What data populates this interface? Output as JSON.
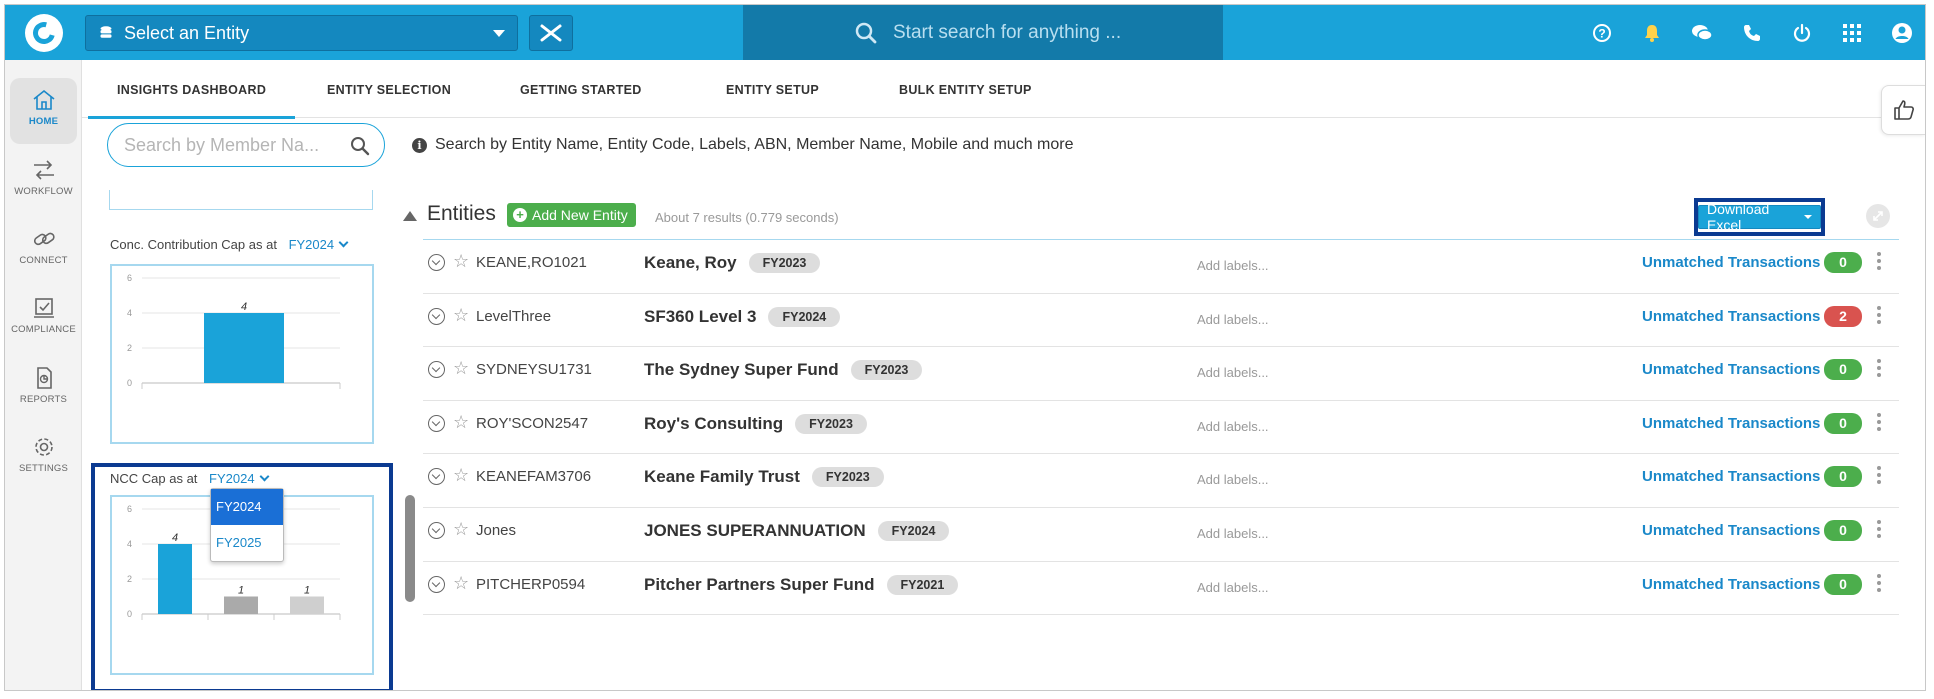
{
  "topbar": {
    "entity_select_label": "Select an Entity",
    "search_placeholder": "Start search for anything ...",
    "icons": [
      "help-icon",
      "bell-icon",
      "chat-icon",
      "phone-icon",
      "power-icon",
      "apps-grid-icon",
      "user-icon"
    ]
  },
  "rail": {
    "items": [
      {
        "label": "HOME",
        "icon": "home-icon",
        "active": true
      },
      {
        "label": "WORKFLOW",
        "icon": "workflow-icon"
      },
      {
        "label": "CONNECT",
        "icon": "link-icon"
      },
      {
        "label": "COMPLIANCE",
        "icon": "compliance-icon"
      },
      {
        "label": "REPORTS",
        "icon": "reports-icon"
      },
      {
        "label": "SETTINGS",
        "icon": "gear-icon"
      }
    ]
  },
  "tabs": [
    "INSIGHTS DASHBOARD",
    "ENTITY SELECTION",
    "GETTING STARTED",
    "ENTITY SETUP",
    "BULK ENTITY SETUP"
  ],
  "member_search": {
    "placeholder": "Search by Member Na...",
    "hint": "Search by Entity Name, Entity Code, Labels, ABN, Member Name, Mobile and much more"
  },
  "left_panel": {
    "cards": [
      {
        "title": "Conc. Contribution Cap as at",
        "fy": "FY2024"
      },
      {
        "title": "NCC Cap as at",
        "fy": "FY2024"
      }
    ],
    "dropdown_options": [
      "FY2024",
      "FY2025"
    ]
  },
  "chart_data": [
    {
      "type": "bar",
      "title": "Conc. Contribution Cap as at FY2024",
      "categories": [
        ""
      ],
      "values": [
        4
      ],
      "ylim": [
        0,
        6
      ],
      "yticks": [
        "0",
        "2",
        "4",
        "6"
      ],
      "colors": [
        "#1aa3d9"
      ]
    },
    {
      "type": "bar",
      "title": "NCC Cap as at FY2024",
      "categories": [
        "",
        "",
        ""
      ],
      "values": [
        4,
        1,
        1
      ],
      "ylim": [
        0,
        6
      ],
      "yticks": [
        "0",
        "2",
        "4",
        "6"
      ],
      "colors": [
        "#1aa3d9",
        "#aaaaaa",
        "#cfcfcf"
      ]
    }
  ],
  "entities": {
    "title": "Entities",
    "add_button": "Add New Entity",
    "results": "About 7 results (0.779 seconds)",
    "download_button": "Download Excel",
    "rows": [
      {
        "code": "KEANE,RO1021",
        "name": "Keane, Roy",
        "fy": "FY2023",
        "labels": "Add labels...",
        "status": "Unmatched Transactions",
        "count": "0",
        "count_color": "#4cae4c"
      },
      {
        "code": "LevelThree",
        "name": "SF360 Level 3",
        "fy": "FY2024",
        "labels": "Add labels...",
        "status": "Unmatched Transactions",
        "count": "2",
        "count_color": "#d9534f"
      },
      {
        "code": "SYDNEYSU1731",
        "name": "The Sydney Super Fund",
        "fy": "FY2023",
        "labels": "Add labels...",
        "status": "Unmatched Transactions",
        "count": "0",
        "count_color": "#4cae4c"
      },
      {
        "code": "ROY'SCON2547",
        "name": "Roy's Consulting",
        "fy": "FY2023",
        "labels": "Add labels...",
        "status": "Unmatched Transactions",
        "count": "0",
        "count_color": "#4cae4c"
      },
      {
        "code": "KEANEFAM3706",
        "name": "Keane Family Trust",
        "fy": "FY2023",
        "labels": "Add labels...",
        "status": "Unmatched Transactions",
        "count": "0",
        "count_color": "#4cae4c"
      },
      {
        "code": "Jones",
        "name": "JONES SUPERANNUATION",
        "fy": "FY2024",
        "labels": "Add labels...",
        "status": "Unmatched Transactions",
        "count": "0",
        "count_color": "#4cae4c"
      },
      {
        "code": "PITCHERP0594",
        "name": "Pitcher Partners Super Fund",
        "fy": "FY2021",
        "labels": "Add labels...",
        "status": "Unmatched Transactions",
        "count": "0",
        "count_color": "#4cae4c"
      }
    ]
  }
}
